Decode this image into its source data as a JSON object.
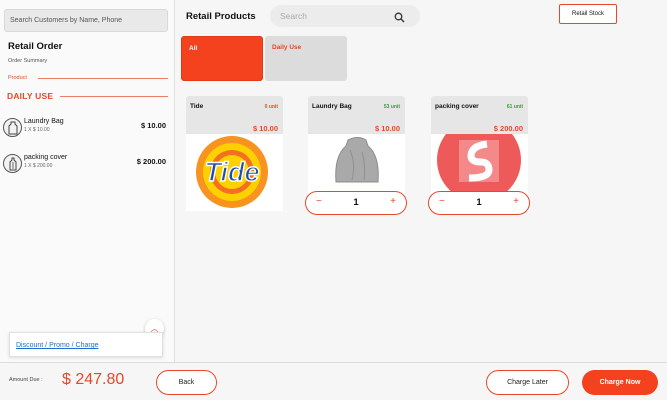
{
  "sidebar": {
    "customer_search_placeholder": "Search Customers by Name, Phone",
    "order_title": "Retail Order",
    "order_subtitle": "Order Summary",
    "product_header": "Product",
    "category": "DAILY USE",
    "items": [
      {
        "name": "Laundry Bag",
        "qty": "1 X $ 10.00",
        "price": "$ 10.00",
        "icon": "laundry-bag-icon"
      },
      {
        "name": "packing cover",
        "qty": "1 X $ 200.00",
        "price": "$ 200.00",
        "icon": "packing-cover-icon"
      }
    ],
    "promo_label": "Discount / Promo / Charge",
    "collapse_icon": "chevron-up-icon"
  },
  "main": {
    "title": "Retail Products",
    "search_placeholder": "Search",
    "stock_button": "Retail Stock",
    "tabs": [
      {
        "label": "All",
        "active": true
      },
      {
        "label": "Daily Use",
        "active": false
      }
    ],
    "products": [
      {
        "name": "Tide",
        "stock": "0 unit",
        "stock_color": "#e8472a",
        "price": "$ 10.00",
        "logo_text": "Tide"
      },
      {
        "name": "Laundry Bag",
        "stock": "53 unit",
        "stock_color": "#3a9a3a",
        "price": "$ 10.00",
        "qty": "1",
        "minus": "−",
        "plus": "+"
      },
      {
        "name": "packing cover",
        "stock": "61 unit",
        "stock_color": "#3a9a3a",
        "price": "$ 200.00",
        "qty": "1",
        "minus": "−",
        "plus": "+"
      }
    ]
  },
  "footer": {
    "amount_label": "Amount Due :",
    "amount_value": "$ 247.80",
    "back_label": "Back",
    "charge_later_label": "Charge Later",
    "charge_now_label": "Charge Now"
  },
  "colors": {
    "accent": "#f4421e",
    "background": "#f6f6f6"
  }
}
